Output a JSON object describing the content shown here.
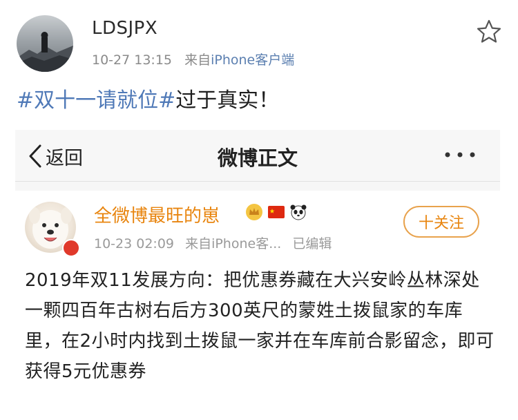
{
  "outer_post": {
    "username": "LDSJPX",
    "timestamp": "10-27 13:15",
    "source_prefix": "来自",
    "source_app": "iPhone客户端",
    "hashtag": "#双十一请就位#",
    "text": "过于真实！",
    "icons": [
      "avatar-image",
      "star-icon"
    ]
  },
  "embedded_screenshot": {
    "nav": {
      "back_label": "返回",
      "title": "微博正文",
      "icons": [
        "chevron-left-icon",
        "more-icon"
      ]
    },
    "post": {
      "author": "全微博最旺的崽",
      "timestamp": "10-23 02:09",
      "source": "来自iPhone客...",
      "edited": "已编辑",
      "follow_button": "十关注",
      "content": "2019年双11发展方向：把优惠券藏在大兴安岭丛林深处一颗四百年古树右后方300英尺的蒙姓土拨鼠家的车库里，在2小时内找到土拨鼠一家并在车库前合影留念，即可获得5元优惠券",
      "badge_icons": [
        "crown-badge-icon",
        "china-flag-icon",
        "panda-icon"
      ]
    }
  },
  "colors": {
    "link_blue": "#4f79b7",
    "orange_name": "#e8850f",
    "meta_gray": "#8a8a8a"
  }
}
